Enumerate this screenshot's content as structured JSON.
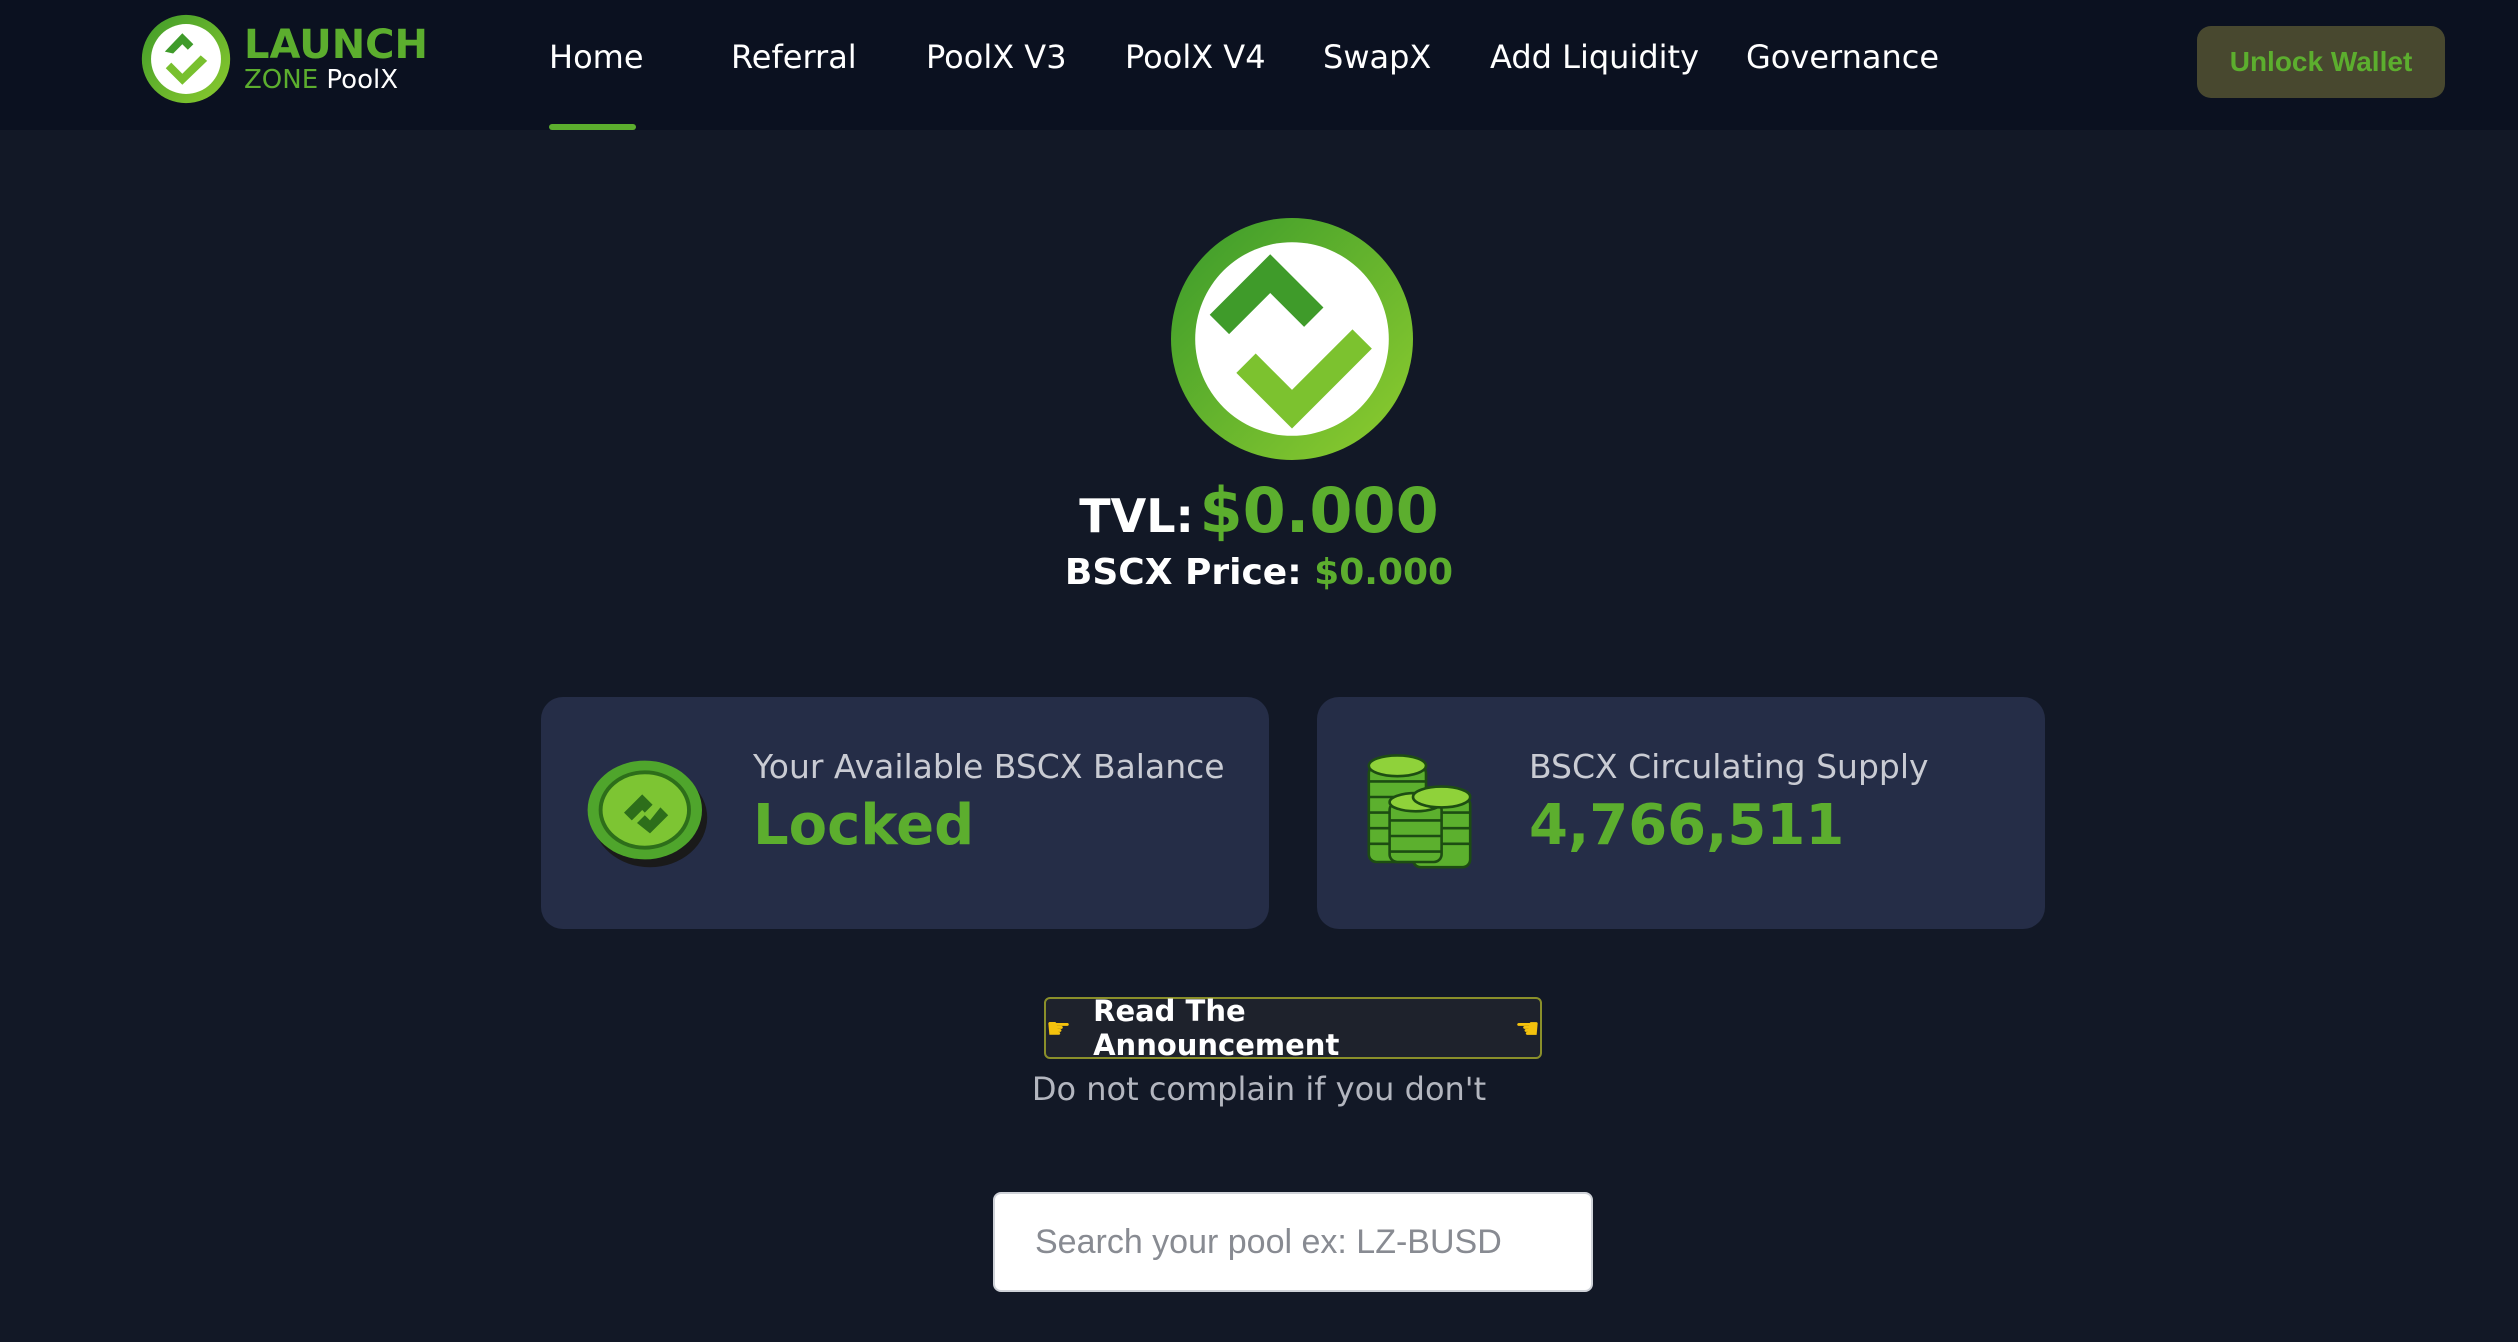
{
  "brand": {
    "line1": "LAUNCH",
    "line2_zone": "ZONE",
    "line2_poolx": "PoolX",
    "logo_icon": "launchzone-logo-icon"
  },
  "nav": {
    "items": [
      {
        "label": "Home",
        "active": true
      },
      {
        "label": "Referral"
      },
      {
        "label": "PoolX V3"
      },
      {
        "label": "PoolX V4"
      },
      {
        "label": "SwapX"
      },
      {
        "label": "Add Liquidity"
      },
      {
        "label": "Governance"
      }
    ]
  },
  "header": {
    "unlock_wallet_label": "Unlock Wallet"
  },
  "hero": {
    "tvl_label": "TVL:",
    "tvl_value": "$0.000",
    "price_label": "BSCX Price:",
    "price_value": "$0.000"
  },
  "cards": {
    "balance": {
      "label": "Your Available BSCX Balance",
      "value": "Locked",
      "icon": "coin-icon"
    },
    "supply": {
      "label": "BSCX Circulating Supply",
      "value": "4,766,511",
      "icon": "coin-stack-icon"
    }
  },
  "announcement": {
    "label": "Read The Announcement",
    "left_icon": "pointing-right-hand-icon",
    "right_icon": "pointing-left-hand-icon",
    "note": "Do not complain if you don't"
  },
  "search": {
    "placeholder": "Search your pool ex: LZ-BUSD"
  },
  "colors": {
    "accent": "#5cae2e",
    "background": "#121826",
    "header_background": "#0b1120",
    "card_background": "#252d47",
    "unlock_button_background": "#48482f"
  }
}
